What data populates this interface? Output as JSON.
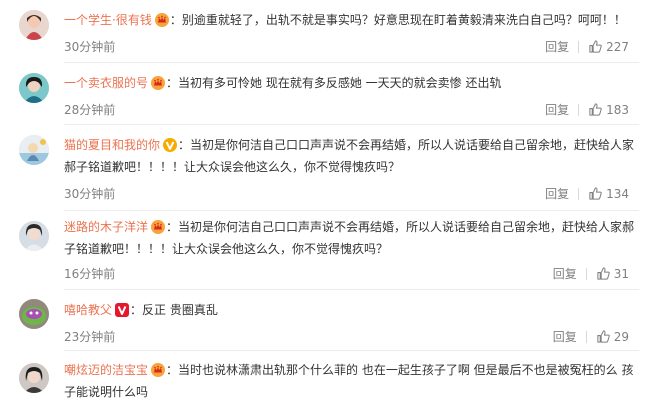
{
  "comments": [
    {
      "user": "一个学生·很有钱",
      "badge": "crown-badge",
      "text": "别逾重就轻了，出轨不就是事实吗？好意思现在盯着黄毅清来洗白自己吗？呵呵！！",
      "time": "30分钟前",
      "reply": "回复",
      "likes": "227"
    },
    {
      "user": "一个卖衣服的号",
      "badge": "crown-badge",
      "text": "当初有多可怜她 现在就有多反感她 一天天的就会卖惨 还出轨",
      "time": "28分钟前",
      "reply": "回复",
      "likes": "183"
    },
    {
      "user": "猫的夏目和我的你",
      "badge": "v-badge",
      "text": "当初是你何洁自己口口声声说不会再结婚，所以人说话要给自己留余地，赶快给人家郝子铭道歉吧！！！！让大众误会他这么久，你不觉得愧疚吗？",
      "time": "30分钟前",
      "reply": "回复",
      "likes": "134"
    },
    {
      "user": "迷路的木子洋洋",
      "badge": "crown-badge",
      "text": "当初是你何洁自己口口声声说不会再结婚，所以人说话要给自己留余地，赶快给人家郝子铭道歉吧！！！！让大众误会他这么久，你不觉得愧疚吗？",
      "time": "16分钟前",
      "reply": "回复",
      "likes": "31"
    },
    {
      "user": "嘻哈教父",
      "badge": "v-badge-red",
      "text": "反正 贵圈真乱",
      "time": "23分钟前",
      "reply": "回复",
      "likes": "29"
    },
    {
      "user": "嘲炫迈的洁宝宝",
      "badge": "crown-badge",
      "text": "当时也说林潇肃出轨那个什么菲的 也在一起生孩子了啊 但是最后不也是被冤枉的么 孩子能说明什么吗",
      "time": "",
      "reply": "",
      "likes": ""
    }
  ],
  "colors": {
    "username": "#eb7350",
    "meta": "#808080",
    "divider": "#ececec"
  }
}
